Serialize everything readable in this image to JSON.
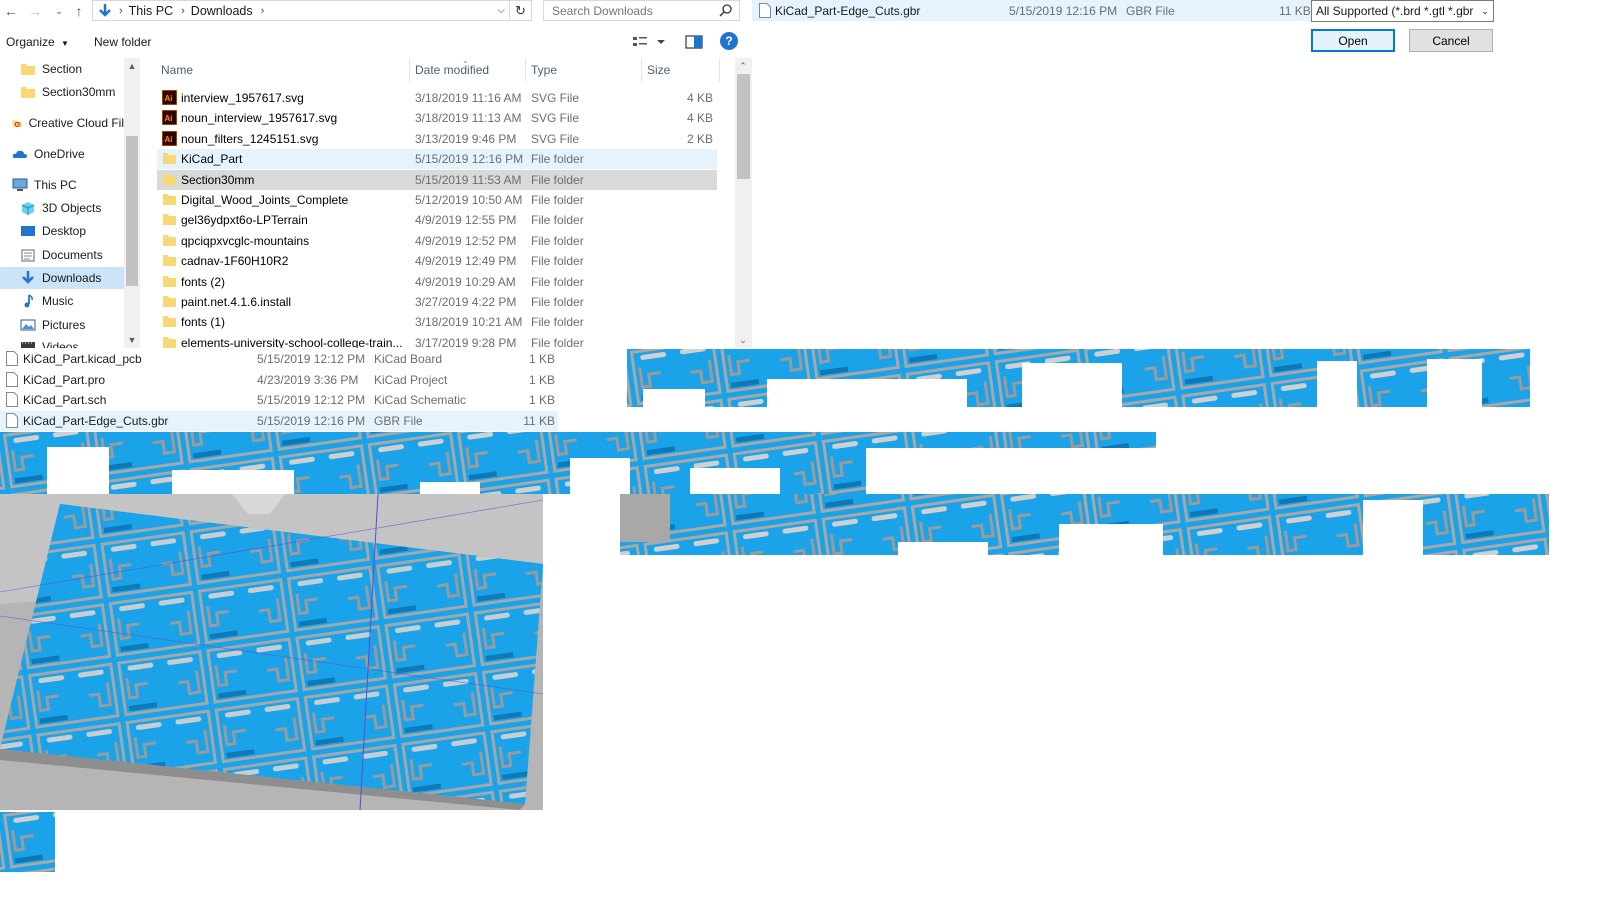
{
  "address_bar": {
    "crumbs": [
      "This PC",
      "Downloads"
    ],
    "search_placeholder": "Search Downloads"
  },
  "toolbar": {
    "organize_label": "Organize",
    "new_folder_label": "New folder"
  },
  "nav_pane": {
    "items": [
      {
        "label": "Section",
        "icon": "folder-icon"
      },
      {
        "label": "Section30mm",
        "icon": "folder-icon"
      },
      {
        "label": "Creative Cloud Fil",
        "icon": "creative-cloud-icon"
      },
      {
        "label": "OneDrive",
        "icon": "cloud-icon"
      },
      {
        "label": "This PC",
        "icon": "computer-icon"
      },
      {
        "label": "3D Objects",
        "icon": "cube-icon"
      },
      {
        "label": "Desktop",
        "icon": "desktop-icon"
      },
      {
        "label": "Documents",
        "icon": "documents-icon"
      },
      {
        "label": "Downloads",
        "icon": "download-icon",
        "selected": true
      },
      {
        "label": "Music",
        "icon": "music-icon"
      },
      {
        "label": "Pictures",
        "icon": "pictures-icon"
      },
      {
        "label": "Videos",
        "icon": "videos-icon"
      }
    ]
  },
  "file_list": {
    "columns": [
      "Name",
      "Date modified",
      "Type",
      "Size"
    ],
    "rows": [
      {
        "name": "interview_1957617.svg",
        "date": "3/18/2019 11:16 AM",
        "type": "SVG File",
        "size": "4 KB",
        "icon": "illustrator-icon"
      },
      {
        "name": "noun_interview_1957617.svg",
        "date": "3/18/2019 11:13 AM",
        "type": "SVG File",
        "size": "4 KB",
        "icon": "illustrator-icon"
      },
      {
        "name": "noun_filters_1245151.svg",
        "date": "3/13/2019 9:46 PM",
        "type": "SVG File",
        "size": "2 KB",
        "icon": "illustrator-icon"
      },
      {
        "name": "KiCad_Part",
        "date": "5/15/2019 12:16 PM",
        "type": "File folder",
        "size": "",
        "icon": "folder-icon",
        "hl": "blue"
      },
      {
        "name": "Section30mm",
        "date": "5/15/2019 11:53 AM",
        "type": "File folder",
        "size": "",
        "icon": "folder-icon",
        "hl": "grey"
      },
      {
        "name": "Digital_Wood_Joints_Complete",
        "date": "5/12/2019 10:50 AM",
        "type": "File folder",
        "size": "",
        "icon": "folder-icon"
      },
      {
        "name": "gel36ydpxt6o-LPTerrain",
        "date": "4/9/2019 12:55 PM",
        "type": "File folder",
        "size": "",
        "icon": "folder-icon"
      },
      {
        "name": "qpciqpxvcglc-mountains",
        "date": "4/9/2019 12:52 PM",
        "type": "File folder",
        "size": "",
        "icon": "folder-icon"
      },
      {
        "name": "cadnav-1F60H10R2",
        "date": "4/9/2019 12:49 PM",
        "type": "File folder",
        "size": "",
        "icon": "folder-icon"
      },
      {
        "name": "fonts (2)",
        "date": "4/9/2019 10:29 AM",
        "type": "File folder",
        "size": "",
        "icon": "folder-icon"
      },
      {
        "name": "paint.net.4.1.6.install",
        "date": "3/27/2019 4:22 PM",
        "type": "File folder",
        "size": "",
        "icon": "folder-icon"
      },
      {
        "name": "fonts (1)",
        "date": "3/18/2019 10:21 AM",
        "type": "File folder",
        "size": "",
        "icon": "folder-icon"
      },
      {
        "name": "elements-university-school-college-train...",
        "date": "3/17/2019 9:28 PM",
        "type": "File folder",
        "size": "",
        "icon": "folder-icon"
      }
    ]
  },
  "selected_file": {
    "name": "KiCad_Part-Edge_Cuts.gbr",
    "date": "5/15/2019 12:16 PM",
    "type": "GBR File",
    "size": "11 KB"
  },
  "dialog": {
    "filter_value": "All Supported (*.brd *.gtl *.gbr *",
    "open_label": "Open",
    "cancel_label": "Cancel"
  },
  "kicad_files": [
    {
      "name": "KiCad_Part.kicad_pcb",
      "date": "5/15/2019 12:12 PM",
      "type": "KiCad Board",
      "size": "1 KB"
    },
    {
      "name": "KiCad_Part.pro",
      "date": "4/23/2019 3:36 PM",
      "type": "KiCad Project",
      "size": "1 KB"
    },
    {
      "name": "KiCad_Part.sch",
      "date": "5/15/2019 12:12 PM",
      "type": "KiCad Schematic",
      "size": "1 KB"
    },
    {
      "name": "KiCad_Part-Edge_Cuts.gbr",
      "date": "5/15/2019 12:16 PM",
      "type": "GBR File",
      "size": "11 KB",
      "hl": true
    }
  ],
  "colors": {
    "part_blue": "#1aa3e8",
    "selection_blue": "#cce4f7",
    "hover_blue": "#e5f3ff",
    "accent": "#0078d7"
  }
}
